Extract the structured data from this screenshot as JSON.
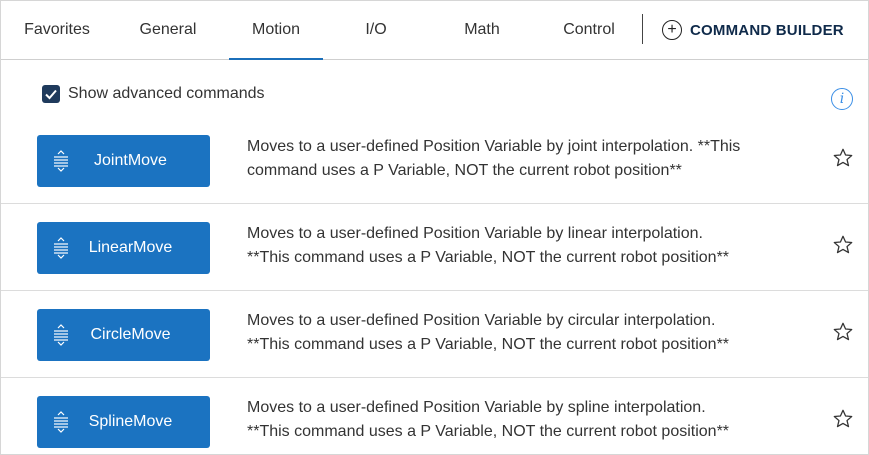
{
  "tabs": [
    {
      "label": "Favorites",
      "active": false
    },
    {
      "label": "General",
      "active": false
    },
    {
      "label": "Motion",
      "active": true
    },
    {
      "label": "I/O",
      "active": false
    },
    {
      "label": "Math",
      "active": false
    },
    {
      "label": "Control",
      "active": false
    }
  ],
  "command_builder": {
    "label": "COMMAND BUILDER",
    "icon": "plus-circle-icon"
  },
  "options": {
    "show_advanced_label": "Show advanced commands",
    "show_advanced_checked": true,
    "info_icon": "info-icon"
  },
  "commands": [
    {
      "name": "JointMove",
      "line1": "Moves to a user-defined Position Variable by joint interpolation. **This",
      "line2": "command uses a P Variable, NOT the current robot position**"
    },
    {
      "name": "LinearMove",
      "line1": "Moves to a user-defined Position Variable by linear interpolation.",
      "line2": "**This command uses a P Variable, NOT the current robot position**"
    },
    {
      "name": "CircleMove",
      "line1": "Moves to a user-defined Position Variable by circular interpolation.",
      "line2": "**This command uses a P Variable, NOT the current robot position**"
    },
    {
      "name": "SplineMove",
      "line1": "Moves to a user-defined Position Variable by spline interpolation.",
      "line2": "**This command uses a P Variable, NOT the current robot position**"
    }
  ],
  "colors": {
    "accent": "#1b73c1",
    "tab_underline": "#1b6fba",
    "checkbox": "#1f3a5c",
    "info": "#3a8ee6"
  }
}
